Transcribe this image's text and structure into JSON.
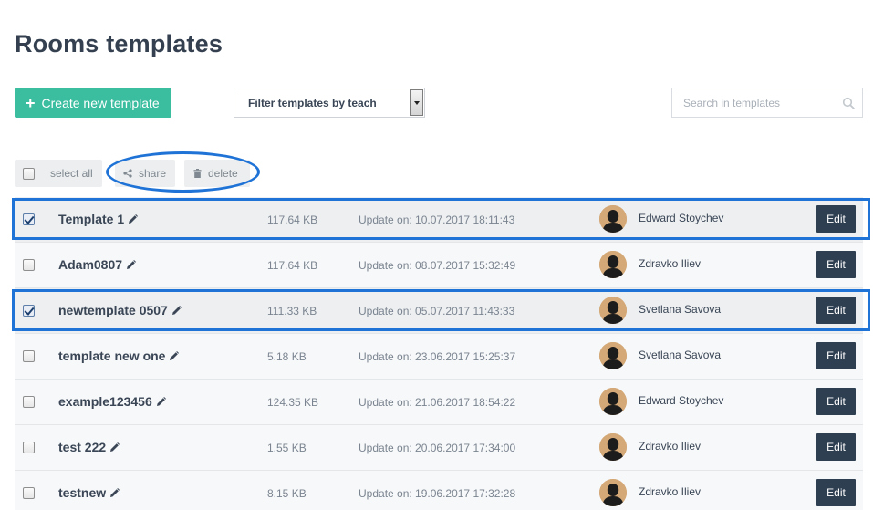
{
  "page": {
    "title": "Rooms templates"
  },
  "toolbar": {
    "create_label": "Create new template",
    "filter_label": "Filter templates by teach",
    "search_placeholder": "Search in templates"
  },
  "actions": {
    "select_all_label": "select all",
    "share_label": "share",
    "delete_label": "delete"
  },
  "templates": [
    {
      "name": "Template 1",
      "size": "117.64 KB",
      "updated": "Update on: 10.07.2017 18:11:43",
      "owner": "Edward Stoychev",
      "edit_label": "Edit",
      "selected": true
    },
    {
      "name": "Adam0807",
      "size": "117.64 KB",
      "updated": "Update on: 08.07.2017 15:32:49",
      "owner": "Zdravko Iliev",
      "edit_label": "Edit",
      "selected": false
    },
    {
      "name": "newtemplate 0507",
      "size": "111.33 KB",
      "updated": "Update on: 05.07.2017 11:43:33",
      "owner": "Svetlana Savova",
      "edit_label": "Edit",
      "selected": true
    },
    {
      "name": "template new one",
      "size": "5.18 KB",
      "updated": "Update on: 23.06.2017 15:25:37",
      "owner": "Svetlana Savova",
      "edit_label": "Edit",
      "selected": false
    },
    {
      "name": "example123456",
      "size": "124.35 KB",
      "updated": "Update on: 21.06.2017 18:54:22",
      "owner": "Edward Stoychev",
      "edit_label": "Edit",
      "selected": false
    },
    {
      "name": "test 222",
      "size": "1.55 KB",
      "updated": "Update on: 20.06.2017 17:34:00",
      "owner": "Zdravko Iliev",
      "edit_label": "Edit",
      "selected": false
    },
    {
      "name": "testnew",
      "size": "8.15 KB",
      "updated": "Update on: 19.06.2017 17:32:28",
      "owner": "Zdravko Iliev",
      "edit_label": "Edit",
      "selected": false
    }
  ],
  "colors": {
    "accent": "#3bbd9f",
    "edit_button": "#2f3f52",
    "highlight": "#1f73d6"
  },
  "icons": {
    "create": "plus-icon",
    "filter": "dropdown-arrow-icon",
    "search": "search-icon",
    "share": "share-icon",
    "delete": "trash-icon",
    "rename": "pencil-icon",
    "owner": "avatar-icon"
  }
}
